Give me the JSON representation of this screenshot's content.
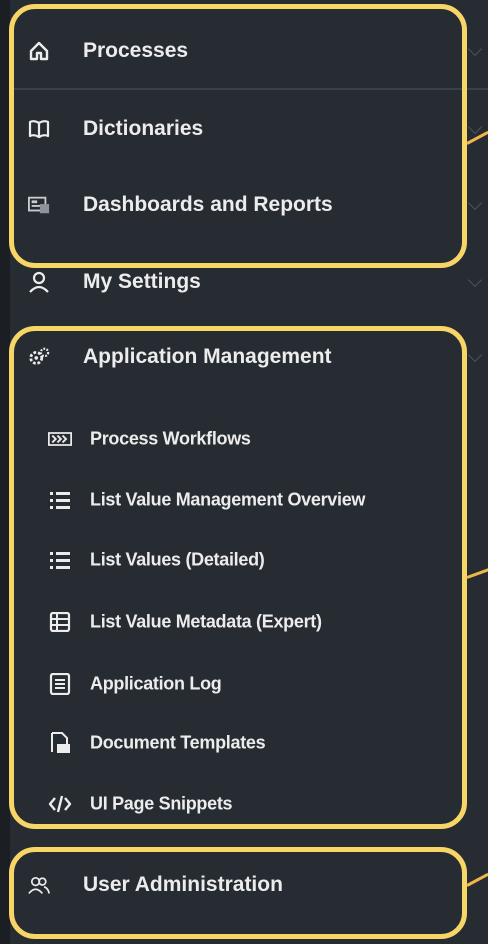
{
  "nav": {
    "processes": "Processes",
    "dictionaries": "Dictionaries",
    "dashboards": "Dashboards and Reports",
    "my_settings": "My Settings",
    "app_management": "Application Management",
    "user_admin": "User Administration"
  },
  "submenu": {
    "process_workflows": "Process Workflows",
    "list_value_overview": "List Value Management Overview",
    "list_values_detailed": "List Values (Detailed)",
    "list_value_metadata": "List Value Metadata (Expert)",
    "application_log": "Application Log",
    "document_templates": "Document Templates",
    "ui_page_snippets": "UI Page Snippets"
  },
  "colors": {
    "sidebar_bg": "#272c33",
    "text": "#ececec",
    "highlight": "#f8d567",
    "pointer": "#f0b64a"
  }
}
